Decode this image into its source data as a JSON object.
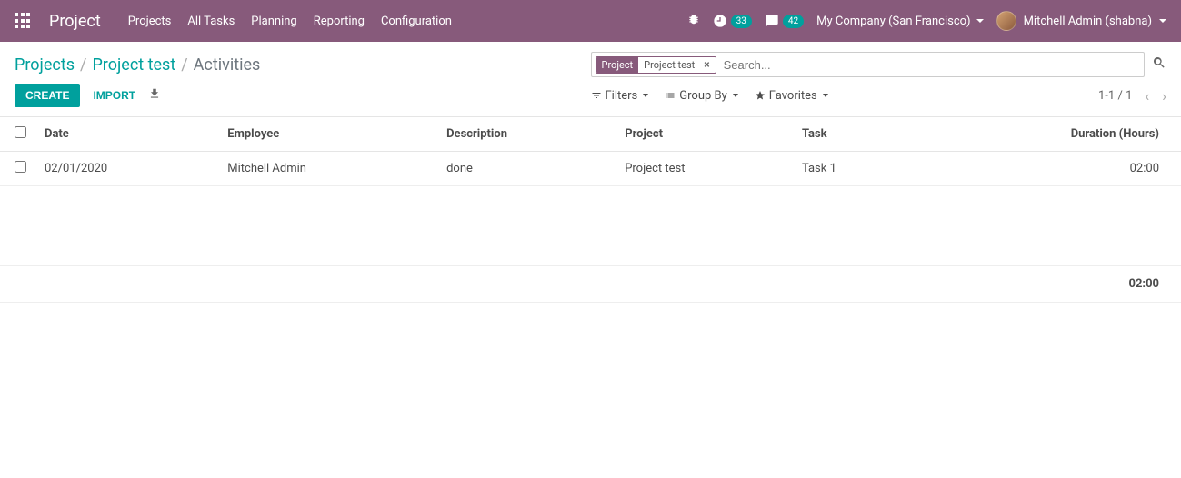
{
  "navbar": {
    "brand": "Project",
    "links": [
      "Projects",
      "All Tasks",
      "Planning",
      "Reporting",
      "Configuration"
    ],
    "activities_count": "33",
    "messages_count": "42",
    "company": "My Company (San Francisco)",
    "user": "Mitchell Admin (shabna)"
  },
  "breadcrumb": {
    "items": [
      "Projects",
      "Project test"
    ],
    "current": "Activities"
  },
  "search": {
    "tag_label": "Project",
    "tag_value": "Project test",
    "placeholder": "Search..."
  },
  "toolbar": {
    "create_label": "CREATE",
    "import_label": "IMPORT"
  },
  "filters": {
    "filters_label": "Filters",
    "group_by_label": "Group By",
    "favorites_label": "Favorites"
  },
  "pager": {
    "range": "1-1",
    "sep": "/",
    "total": "1"
  },
  "table": {
    "headers": {
      "date": "Date",
      "employee": "Employee",
      "description": "Description",
      "project": "Project",
      "task": "Task",
      "duration": "Duration (Hours)"
    },
    "rows": [
      {
        "date": "02/01/2020",
        "employee": "Mitchell Admin",
        "description": "done",
        "project": "Project test",
        "task": "Task 1",
        "duration": "02:00"
      }
    ],
    "footer": {
      "duration_total": "02:00"
    }
  }
}
